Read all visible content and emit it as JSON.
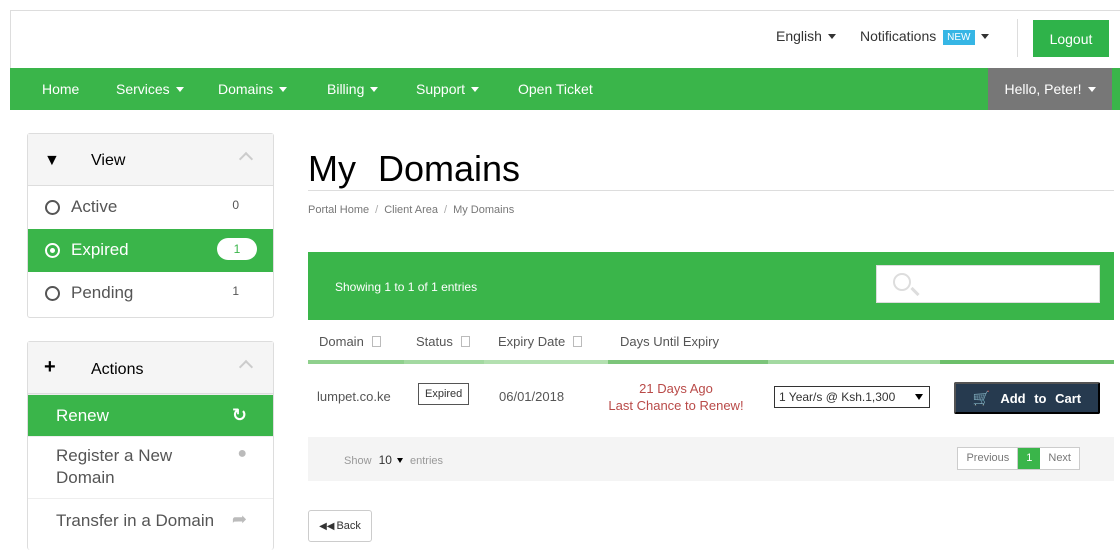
{
  "topbar": {
    "language": "English",
    "notifications_label": "Notifications",
    "notifications_badge": "NEW",
    "logout_label": "Logout"
  },
  "navbar": {
    "items": [
      {
        "label": "Home",
        "dropdown": false
      },
      {
        "label": "Services",
        "dropdown": true
      },
      {
        "label": "Domains",
        "dropdown": true
      },
      {
        "label": "Billing",
        "dropdown": true
      },
      {
        "label": "Support",
        "dropdown": true
      },
      {
        "label": "Open Ticket",
        "dropdown": false
      }
    ],
    "user_greeting": "Hello, Peter!"
  },
  "sidebar": {
    "view": {
      "title": "View",
      "items": [
        {
          "label": "Active",
          "count": "0",
          "selected": false
        },
        {
          "label": "Expired",
          "count": "1",
          "selected": true
        },
        {
          "label": "Pending",
          "count": "1",
          "selected": false
        }
      ]
    },
    "actions": {
      "title": "Actions",
      "items": [
        {
          "label": "Renew",
          "icon": "refresh-icon",
          "active": true
        },
        {
          "label": "Register a New Domain",
          "icon": "globe-icon",
          "active": false
        },
        {
          "label": "Transfer in a Domain",
          "icon": "share-arrow-icon",
          "active": false
        }
      ]
    }
  },
  "main": {
    "title": "My Domains",
    "breadcrumb": [
      "Portal Home",
      "Client Area",
      "My Domains"
    ],
    "table": {
      "showing": "Showing 1 to 1 of 1 entries",
      "search_placeholder": "",
      "columns": [
        "Domain",
        "Status",
        "Expiry Date",
        "Days Until Expiry"
      ],
      "rows": [
        {
          "domain": "lumpet.co.ke",
          "status": "Expired",
          "expiry_date": "06/01/2018",
          "days_line1": "21 Days Ago",
          "days_line2": "Last Chance to Renew!",
          "term": "1 Year/s @ Ksh.1,300",
          "add_to_cart": "Add to Cart"
        }
      ],
      "footer": {
        "show_label": "Show",
        "page_length": "10",
        "entries_label": "entries",
        "previous": "Previous",
        "current_page": "1",
        "next": "Next"
      }
    },
    "back_label": "Back"
  },
  "colors": {
    "brand_green": "#3ab54a",
    "user_menu_gray": "#777777",
    "cart_button": "#263a4f",
    "warning_text": "#b94a48",
    "new_badge": "#36b6e5"
  }
}
